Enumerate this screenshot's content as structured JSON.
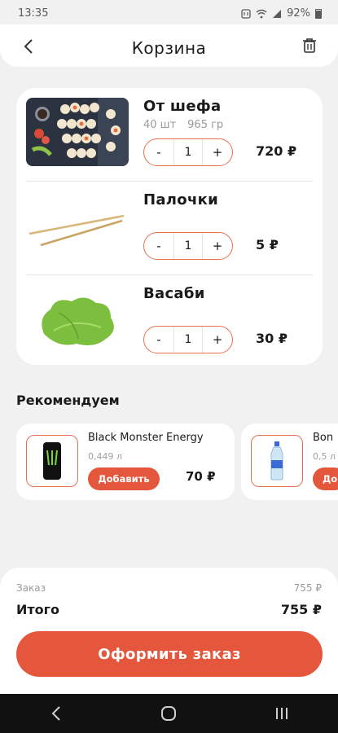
{
  "status": {
    "time": "13:35",
    "battery": "92%"
  },
  "header": {
    "title": "Корзина",
    "back_icon": "chevron-left-icon",
    "trash_icon": "trash-icon"
  },
  "cart": {
    "items": [
      {
        "name": "От шефа",
        "count": "40 шт",
        "weight": "965 гр",
        "minus": "-",
        "qty": "1",
        "plus": "+",
        "price": "720 ₽",
        "image": "sushi-set"
      },
      {
        "name": "Палочки",
        "minus": "-",
        "qty": "1",
        "plus": "+",
        "price": "5 ₽",
        "image": "chopsticks"
      },
      {
        "name": "Васаби",
        "minus": "-",
        "qty": "1",
        "plus": "+",
        "price": "30 ₽",
        "image": "wasabi-leaf"
      }
    ]
  },
  "recommend": {
    "title": "Рекомендуем",
    "items": [
      {
        "name": "Black Monster Energy",
        "volume": "0,449 л",
        "add_label": "Добавить",
        "price": "70 ₽"
      },
      {
        "name": "Bon",
        "volume": "0,5 л",
        "add_label": "До"
      }
    ]
  },
  "summary": {
    "order_label": "Заказ",
    "order_value": "755 ₽",
    "total_label": "Итого",
    "total_value": "755 ₽",
    "checkout_label": "Оформить заказ"
  },
  "colors": {
    "accent": "#e5573d",
    "outline": "#e96f52",
    "background": "#f1f1f1"
  }
}
